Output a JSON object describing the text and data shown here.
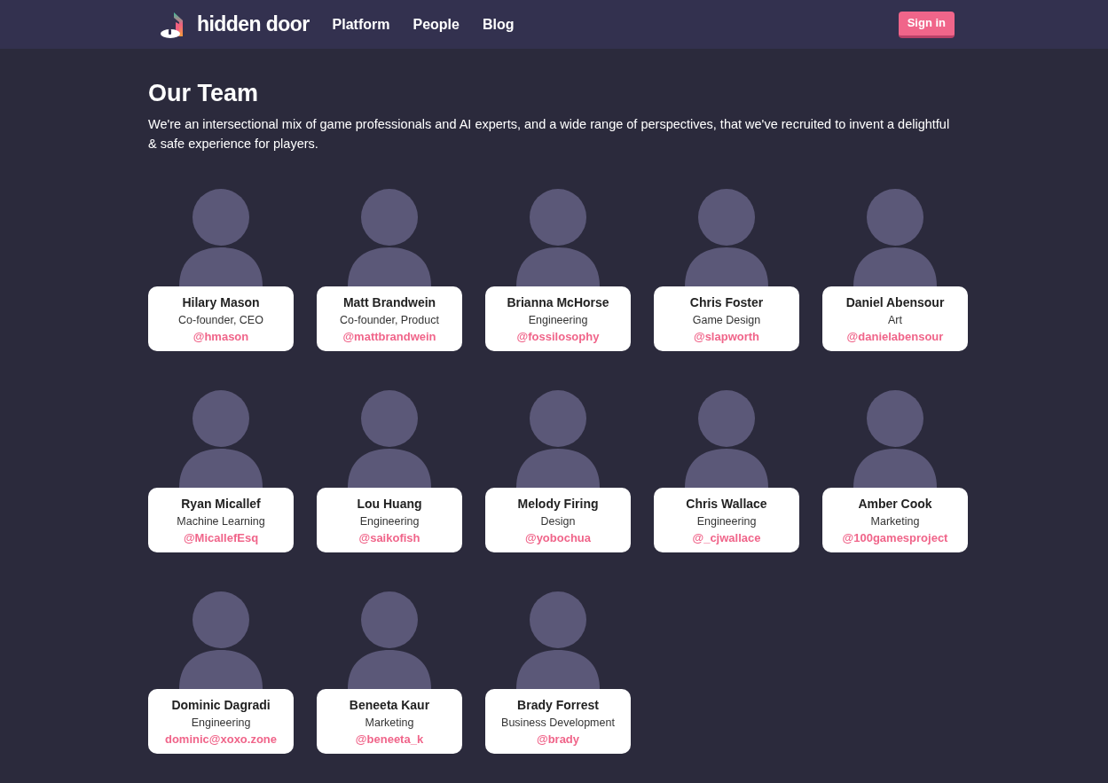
{
  "header": {
    "logo_text": "hidden door",
    "nav": [
      {
        "label": "Platform"
      },
      {
        "label": "People"
      },
      {
        "label": "Blog"
      }
    ],
    "sign_in": "Sign in"
  },
  "title": "Our Team",
  "intro": "We're an intersectional mix of game professionals and AI experts, and a wide range of perspectives, that we've recruited to invent a delightful & safe experience for players.",
  "members": [
    {
      "name": "Hilary Mason",
      "role": "Co-founder, CEO",
      "handle": "@hmason"
    },
    {
      "name": "Matt Brandwein",
      "role": "Co-founder, Product",
      "handle": "@mattbrandwein"
    },
    {
      "name": "Brianna McHorse",
      "role": "Engineering",
      "handle": "@fossilosophy"
    },
    {
      "name": "Chris Foster",
      "role": "Game Design",
      "handle": "@slapworth"
    },
    {
      "name": "Daniel Abensour",
      "role": "Art",
      "handle": "@danielabensour"
    },
    {
      "name": "Ryan Micallef",
      "role": "Machine Learning",
      "handle": "@MicallefEsq"
    },
    {
      "name": "Lou Huang",
      "role": "Engineering",
      "handle": "@saikofish"
    },
    {
      "name": "Melody Firing",
      "role": "Design",
      "handle": "@yobochua"
    },
    {
      "name": "Chris Wallace",
      "role": "Engineering",
      "handle": "@_cjwallace"
    },
    {
      "name": "Amber Cook",
      "role": "Marketing",
      "handle": "@100gamesproject"
    },
    {
      "name": "Dominic Dagradi",
      "role": "Engineering",
      "handle": "dominic@xoxo.zone"
    },
    {
      "name": "Beneeta Kaur",
      "role": "Marketing",
      "handle": "@beneeta_k"
    },
    {
      "name": "Brady Forrest",
      "role": "Business Development",
      "handle": "@brady"
    }
  ]
}
